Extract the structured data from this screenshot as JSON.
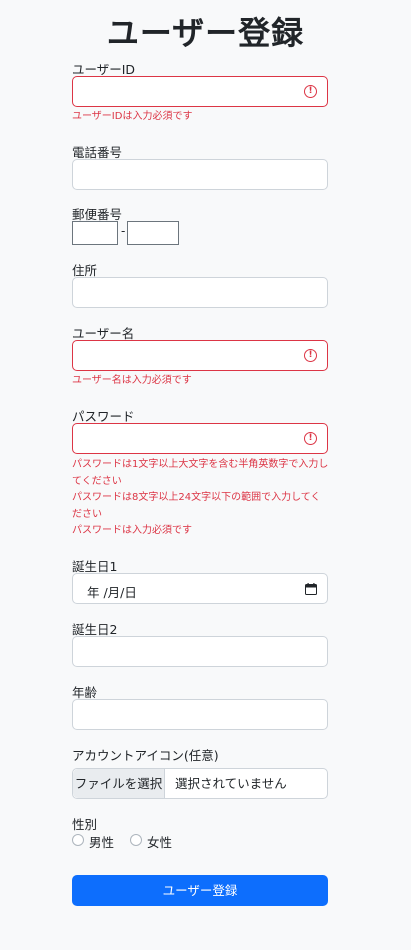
{
  "page": {
    "title": "ユーザー登録"
  },
  "fields": {
    "user_id": {
      "label": "ユーザーID",
      "value": "",
      "error": "ユーザーIDは入力必須です"
    },
    "phone": {
      "label": "電話番号",
      "value": ""
    },
    "zip": {
      "label": "郵便番号",
      "first": "",
      "second": "",
      "separator": "-"
    },
    "address": {
      "label": "住所",
      "value": ""
    },
    "username": {
      "label": "ユーザー名",
      "value": "",
      "error": "ユーザー名は入力必須です"
    },
    "password": {
      "label": "パスワード",
      "value": "",
      "errors": [
        "パスワードは1文字以上大文字を含む半角英数字で入力してください",
        "パスワードは8文字以上24文字以下の範囲で入力してください",
        "パスワードは入力必須です"
      ]
    },
    "birthday1": {
      "label": "誕生日1",
      "display": "年 /月/日"
    },
    "birthday2": {
      "label": "誕生日2",
      "value": ""
    },
    "age": {
      "label": "年齢",
      "value": ""
    },
    "avatar": {
      "label": "アカウントアイコン(任意)",
      "button": "ファイルを選択",
      "status": "選択されていません"
    },
    "gender": {
      "label": "性別",
      "options": [
        "男性",
        "女性"
      ]
    }
  },
  "submit": {
    "label": "ユーザー登録"
  },
  "colors": {
    "error": "#dc3545",
    "primary": "#0d6efd",
    "background": "#f8f9fa"
  },
  "icons": {
    "invalid": "exclamation-circle-icon",
    "calendar": "calendar-icon"
  }
}
